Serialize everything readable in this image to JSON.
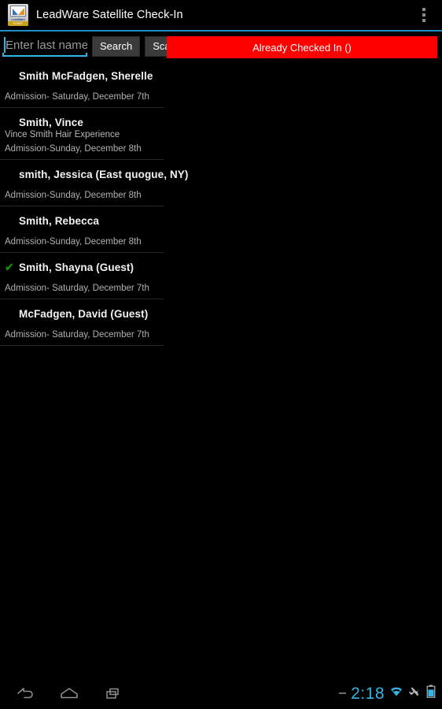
{
  "titlebar": {
    "app_name": "LeadWare Satellite Check-In",
    "logo_brand": "LeadWare",
    "logo_ribbon": "EVENT SOFTWARE",
    "overflow_icon": "overflow-menu-icon",
    "accent_color": "#1e8ec4"
  },
  "search": {
    "placeholder": "Enter last name",
    "value": "",
    "search_label": "Search",
    "scan_label": "Scan",
    "caret_color": "#33b5e5"
  },
  "banner": {
    "label": "Already Checked In ()",
    "color": "#fe0000"
  },
  "list": {
    "items": [
      {
        "name": "Smith McFadgen, Sherelle",
        "company": "",
        "admission": "Admission- Saturday, December 7th",
        "checked_in": false
      },
      {
        "name": "Smith, Vince",
        "company": "Vince Smith Hair Experience",
        "admission": "Admission-Sunday, December 8th",
        "checked_in": false
      },
      {
        "name": "smith, Jessica (East quogue, NY)",
        "company": "",
        "admission": "Admission-Sunday, December 8th",
        "checked_in": false
      },
      {
        "name": "Smith, Rebecca",
        "company": "",
        "admission": "Admission-Sunday, December 8th",
        "checked_in": false
      },
      {
        "name": "Smith, Shayna (Guest)",
        "company": "",
        "admission": "Admission- Saturday, December 7th",
        "checked_in": true
      },
      {
        "name": "McFadgen, David (Guest)",
        "company": "",
        "admission": "Admission- Saturday, December 7th",
        "checked_in": false
      }
    ],
    "check_glyph": "✔",
    "check_color": "#108a10"
  },
  "systembar": {
    "back_icon": "back-arrow-icon",
    "home_icon": "home-icon",
    "recents_icon": "recent-apps-icon",
    "dash_icon": "no-signal-icon",
    "clock": "2:18",
    "wifi_icon": "wifi-icon",
    "airplane_icon": "airplane-mode-icon",
    "battery_icon": "battery-icon",
    "clock_color": "#33b5e5"
  }
}
